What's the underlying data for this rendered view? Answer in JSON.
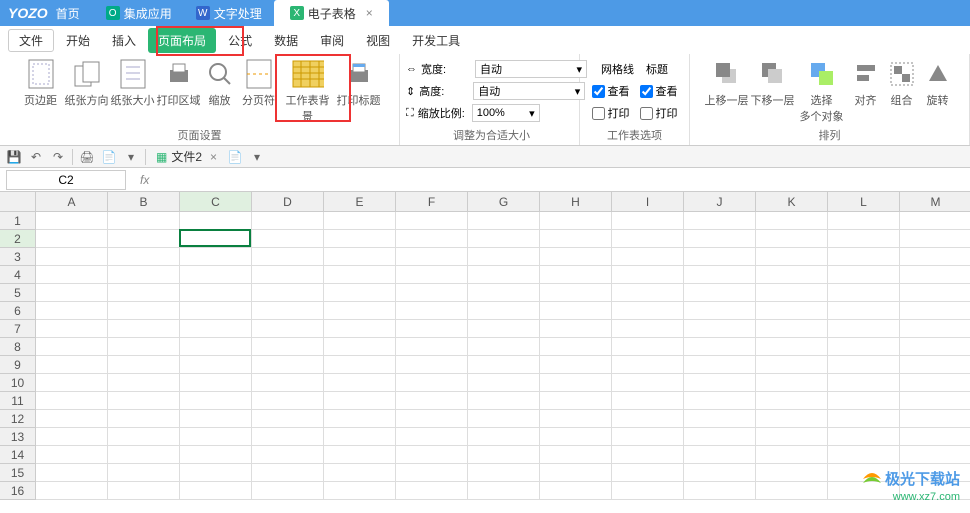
{
  "titlebar": {
    "brand": "YOZO",
    "home": "首页",
    "tabs": [
      {
        "icon": "O",
        "label": "集成应用"
      },
      {
        "icon": "W",
        "label": "文字处理"
      },
      {
        "icon": "X",
        "label": "电子表格",
        "active": true
      }
    ]
  },
  "menu": {
    "file": "文件",
    "items": [
      "开始",
      "插入",
      "页面布局",
      "公式",
      "数据",
      "审阅",
      "视图",
      "开发工具"
    ],
    "active": "页面布局"
  },
  "ribbon": {
    "group_page": {
      "title": "页面设置",
      "items": [
        "页边距",
        "纸张方向",
        "纸张大小",
        "打印区域",
        "缩放",
        "分页符",
        "工作表背景",
        "打印标题"
      ]
    },
    "group_size": {
      "title": "调整为合适大小",
      "width_label": "宽度:",
      "width_value": "自动",
      "height_label": "高度:",
      "height_value": "自动",
      "scale_label": "缩放比例:",
      "scale_value": "100%"
    },
    "group_sheet": {
      "title": "工作表选项",
      "grid_label": "网格线",
      "heading_label": "标题",
      "view_label": "查看",
      "print_label": "打印"
    },
    "group_arrange": {
      "title": "排列",
      "items": [
        "上移一层",
        "下移一层",
        "选择\n多个对象",
        "对齐",
        "组合",
        "旋转"
      ]
    }
  },
  "qat": {
    "doc_name": "文件2"
  },
  "formula": {
    "cell_ref": "C2",
    "fx": "fx"
  },
  "sheet": {
    "columns": [
      "A",
      "B",
      "C",
      "D",
      "E",
      "F",
      "G",
      "H",
      "I",
      "J",
      "K",
      "L",
      "M"
    ],
    "rows": [
      "1",
      "2",
      "3",
      "4",
      "5",
      "6",
      "7",
      "8",
      "9",
      "10",
      "11",
      "12",
      "13",
      "14",
      "15",
      "16"
    ],
    "active_col": "C",
    "active_row": "2"
  },
  "watermark": {
    "name": "极光下载站",
    "url": "www.xz7.com"
  }
}
